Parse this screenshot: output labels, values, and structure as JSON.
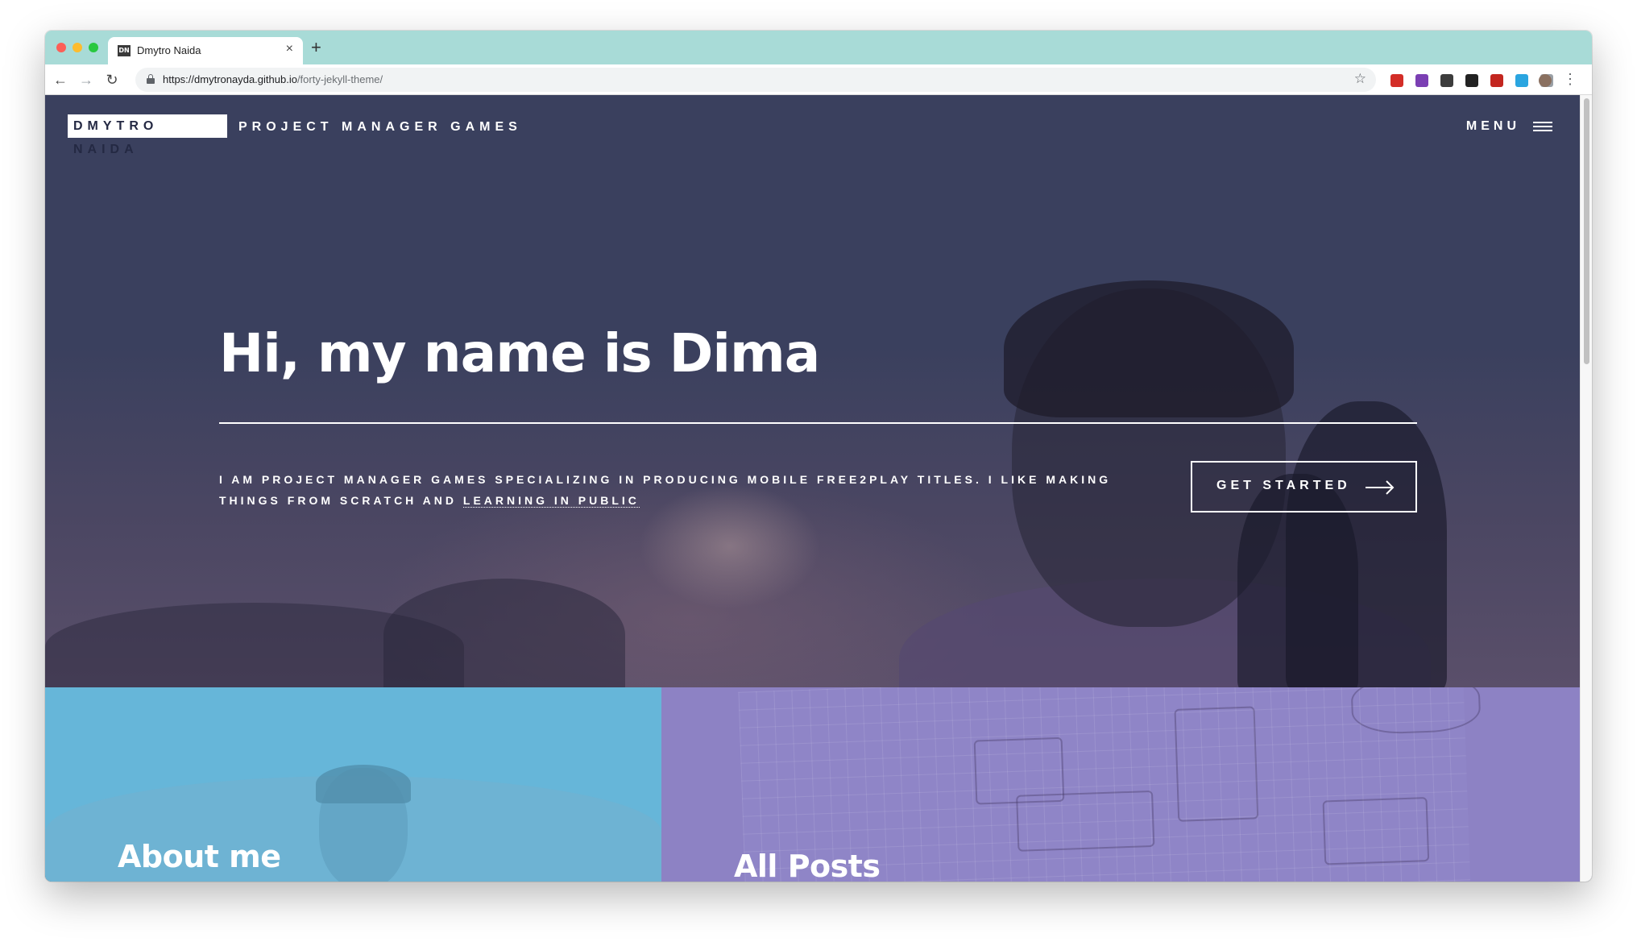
{
  "browser": {
    "tab_title": "Dmytro Naida",
    "tab_favicon": "DN",
    "tab_close": "×",
    "new_tab": "+",
    "url_host": "https://dmytronayda.github.io",
    "url_path": "/forty-jekyll-theme/",
    "extensions": [
      {
        "name": "lastpass-ext-icon",
        "color": "#d32d27"
      },
      {
        "name": "onenote-ext-icon",
        "color": "#7b3fb3"
      },
      {
        "name": "openai-ext-icon",
        "color": "#3c3c3c"
      },
      {
        "name": "calendar-ext-icon",
        "color": "#222222"
      },
      {
        "name": "ruby-ext-icon",
        "color": "#c3261f"
      },
      {
        "name": "at-ext-icon",
        "color": "#2aa5e0"
      },
      {
        "name": "camera-ext-icon",
        "color": "#9aa0a6"
      }
    ]
  },
  "site": {
    "logo": "DMYTRO NAIDA",
    "subtitle": "PROJECT MANAGER GAMES",
    "menu": "MENU"
  },
  "hero": {
    "title": "Hi, my name is Dima",
    "text": "I AM PROJECT MANAGER GAMES SPECIALIZING IN PRODUCING MOBILE FREE2PLAY TITLES. I LIKE MAKING THINGS FROM SCRATCH AND ",
    "link": "LEARNING IN PUBLIC",
    "cta": "GET STARTED"
  },
  "tiles": [
    {
      "title": "About me",
      "color": "#66b6d9"
    },
    {
      "title": "All Posts",
      "color": "#8d82c4"
    }
  ],
  "colors": {
    "page_bg": "#242943",
    "accent_blue": "#66b6d9",
    "accent_purple": "#8d82c4"
  }
}
